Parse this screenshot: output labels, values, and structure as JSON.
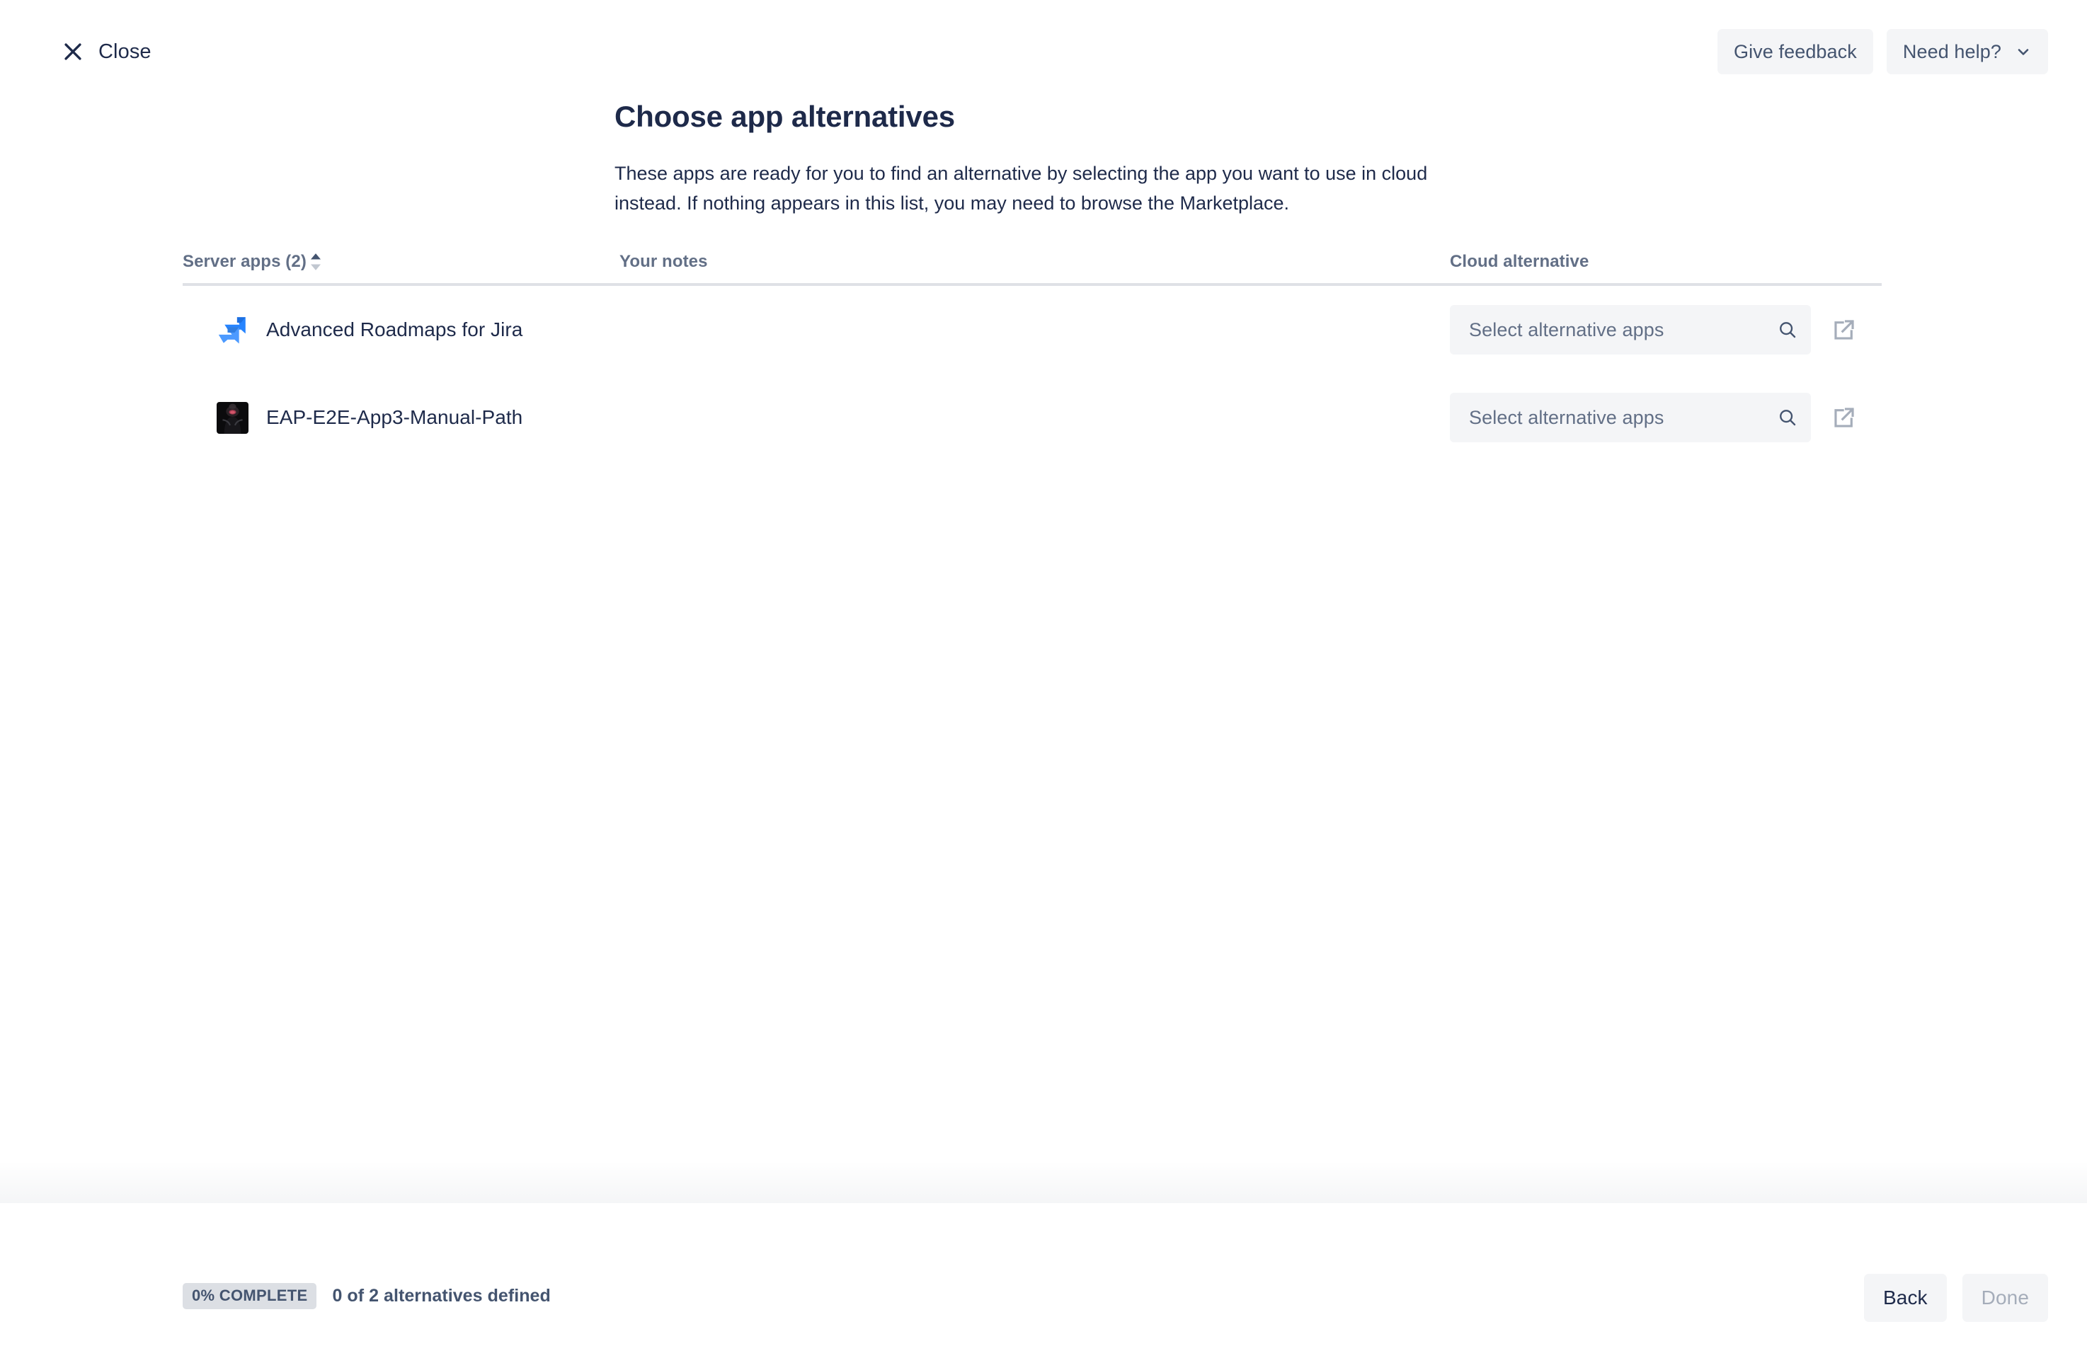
{
  "topbar": {
    "close_label": "Close",
    "close_icon": "close-icon",
    "give_feedback_label": "Give feedback",
    "need_help_label": "Need help?",
    "need_help_icon": "chevron-down-icon"
  },
  "header": {
    "title": "Choose app alternatives",
    "description": "These apps are ready for you to find an alternative by selecting the app you want to use in cloud instead. If nothing appears in this list, you may need to browse the Marketplace."
  },
  "table": {
    "columns": [
      {
        "label": "Server apps (2)",
        "sortable": true,
        "sort_direction": "asc",
        "sort_icon": "sort-arrows-icon"
      },
      {
        "label": "Your notes",
        "sortable": false
      },
      {
        "label": "Cloud alternative",
        "sortable": false
      }
    ],
    "rows": [
      {
        "app_name": "Advanced Roadmaps for Jira",
        "app_icon": "jira-roadmaps-icon",
        "notes": "",
        "alternative_placeholder": "Select alternative apps",
        "search_icon": "search-icon",
        "external_link_icon": "external-link-icon"
      },
      {
        "app_name": "EAP-E2E-App3-Manual-Path",
        "app_icon": "app-avatar-icon",
        "notes": "",
        "alternative_placeholder": "Select alternative apps",
        "search_icon": "search-icon",
        "external_link_icon": "external-link-icon"
      }
    ]
  },
  "footer": {
    "progress_badge": "0% COMPLETE",
    "progress_text": "0 of 2 alternatives defined",
    "back_label": "Back",
    "done_label": "Done"
  },
  "colors": {
    "text_primary": "#1e2a4a",
    "text_subtle": "#626f86",
    "text_disabled": "#a5adba",
    "surface_subtle": "#f4f5f7",
    "border": "#dfe1e6",
    "badge_bg": "#dcdfe4",
    "brand_blue": "#2684ff"
  }
}
